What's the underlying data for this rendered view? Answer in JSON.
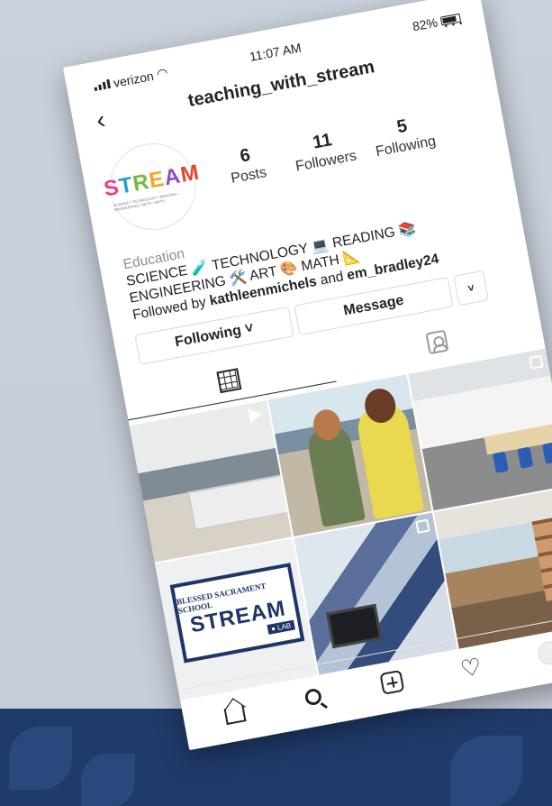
{
  "status_bar": {
    "carrier": "verizon",
    "time": "11:07 AM",
    "battery": "82%"
  },
  "header": {
    "username": "teaching_with_stream",
    "back_glyph": "‹",
    "more_glyph": "···"
  },
  "profile": {
    "avatar_logo": [
      "S",
      "T",
      "R",
      "E",
      "A",
      "M"
    ],
    "avatar_tagline": "SCIENCE • TECHNOLOGY • READING • ENGINEERING • ARTS • MATH",
    "stats": [
      {
        "value": "6",
        "label": "Posts"
      },
      {
        "value": "11",
        "label": "Followers"
      },
      {
        "value": "5",
        "label": "Following"
      }
    ]
  },
  "bio": {
    "category": "Education",
    "line1": "SCIENCE 🧪 TECHNOLOGY 💻 READING 📚",
    "line2": "ENGINEERING 🛠️ ART 🎨 MATH 📐",
    "followed_prefix": "Followed by ",
    "followed_user1": "kathleenmichels",
    "followed_and": " and ",
    "followed_user2": "em_bradley24"
  },
  "actions": {
    "following_label": "Following ˅",
    "message_label": "Message",
    "more_label": "˅"
  },
  "photos": {
    "sign_top": "BLESSED SACRAMENT SCHOOL",
    "sign_main": "STREAM",
    "sign_lab": "● LAB"
  },
  "icons": {
    "back": "chevron-left-icon",
    "more": "ellipsis-icon",
    "grid": "grid-icon",
    "tagged": "tagged-person-icon",
    "home": "home-icon",
    "search": "search-icon",
    "add": "add-post-icon",
    "activity": "heart-icon",
    "profile": "profile-avatar-icon"
  },
  "colors": {
    "brand_navy": "#203a6a",
    "text": "#222222"
  }
}
